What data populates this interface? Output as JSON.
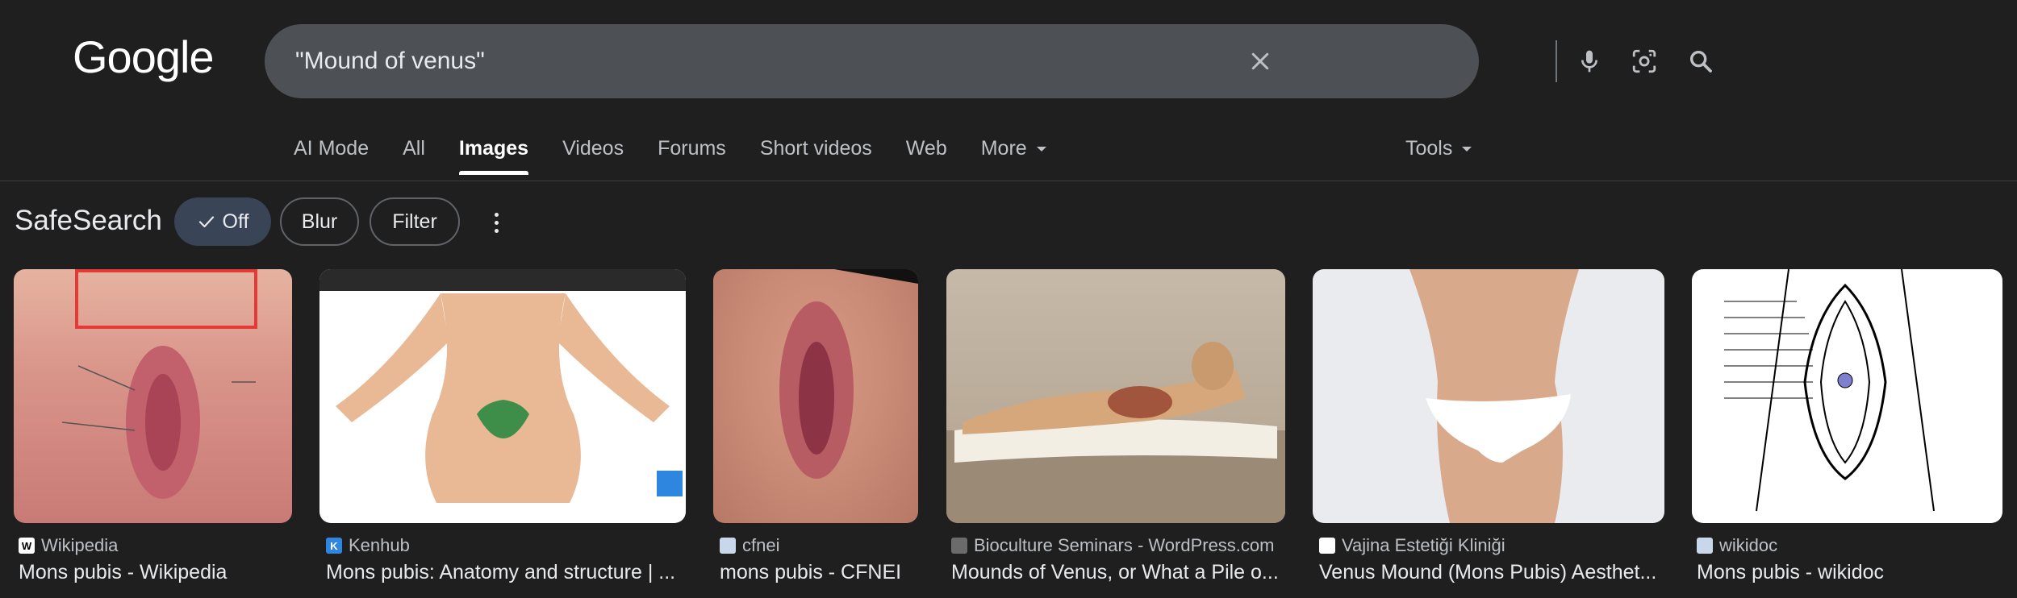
{
  "logo": "Google",
  "search": {
    "value": "\"Mound of venus\""
  },
  "tabs": [
    {
      "label": "AI Mode"
    },
    {
      "label": "All"
    },
    {
      "label": "Images"
    },
    {
      "label": "Videos"
    },
    {
      "label": "Forums"
    },
    {
      "label": "Short videos"
    },
    {
      "label": "Web"
    },
    {
      "label": "More"
    }
  ],
  "tools_label": "Tools",
  "safesearch": {
    "title": "SafeSearch",
    "off": "Off",
    "blur": "Blur",
    "filter": "Filter"
  },
  "results": [
    {
      "source": "Wikipedia",
      "title": "Mons pubis - Wikipedia",
      "favicon": "W"
    },
    {
      "source": "Kenhub",
      "title": "Mons pubis: Anatomy and structure | ...",
      "favicon": "K"
    },
    {
      "source": "cfnei",
      "title": "mons pubis - CFNEI",
      "favicon": ""
    },
    {
      "source": "Bioculture Seminars - WordPress.com",
      "title": "Mounds of Venus, or What a Pile o...",
      "favicon": ""
    },
    {
      "source": "Vajina Estetiği Kliniği",
      "title": "Venus Mound (Mons Pubis) Aesthet...",
      "favicon": ""
    },
    {
      "source": "wikidoc",
      "title": "Mons pubis - wikidoc",
      "favicon": ""
    }
  ],
  "colors": {
    "background": "#1f1f1f",
    "searchbar": "#4d5156",
    "chip_active": "#394457",
    "text": "#e8eaed",
    "muted": "#bdc1c6"
  }
}
